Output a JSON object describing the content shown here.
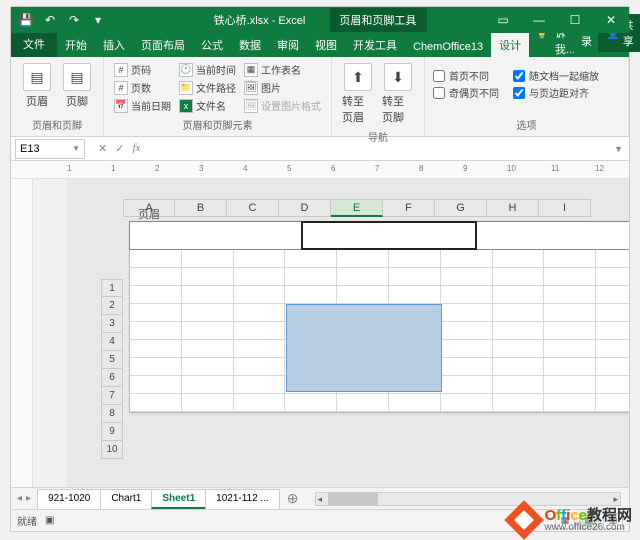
{
  "titlebar": {
    "doc": "铁心桥.xlsx - Excel",
    "context": "页眉和页脚工具"
  },
  "tabs": {
    "file": "文件",
    "home": "开始",
    "insert": "插入",
    "pagelayout": "页面布局",
    "formulas": "公式",
    "data": "数据",
    "review": "审阅",
    "view": "视图",
    "developer": "开发工具",
    "chem": "ChemOffice13",
    "design": "设计",
    "tell": "告诉我...",
    "login": "登录",
    "share": "共享"
  },
  "ribbon": {
    "g1": {
      "header": "页眉",
      "footer": "页脚",
      "label": "页眉和页脚"
    },
    "g2": {
      "pagenum": "页码",
      "pagecount": "页数",
      "curdate": "当前日期",
      "curtime": "当前时间",
      "filepath": "文件路径",
      "filename": "文件名",
      "sheetname": "工作表名",
      "picture": "图片",
      "picfmt": "设置图片格式",
      "label": "页眉和页脚元素"
    },
    "g3": {
      "gohdr": "转至页眉",
      "goftr": "转至页脚",
      "label": "导航"
    },
    "g4": {
      "firstdiff": "首页不同",
      "odddiff": "奇偶页不同",
      "scaledoc": "随文档一起缩放",
      "alignmargin": "与页边距对齐",
      "label": "选项"
    }
  },
  "namebox": "E13",
  "cols": [
    "A",
    "B",
    "C",
    "D",
    "E",
    "F",
    "G",
    "H",
    "I"
  ],
  "rows": [
    "1",
    "2",
    "3",
    "4",
    "5",
    "6",
    "7",
    "8",
    "9",
    "10"
  ],
  "ruler_marks": [
    "1",
    "1",
    "2",
    "3",
    "4",
    "5",
    "6",
    "7",
    "8",
    "9",
    "10",
    "11",
    "12"
  ],
  "header_label": "页眉",
  "sheets": {
    "s1": "921-1020",
    "s2": "Chart1",
    "s3": "Sheet1",
    "s4": "1021-112 ..."
  },
  "status": {
    "ready": "就绪"
  },
  "watermark": {
    "brand": "Office",
    "suffix": "教程网",
    "url": "www.office26.com"
  }
}
